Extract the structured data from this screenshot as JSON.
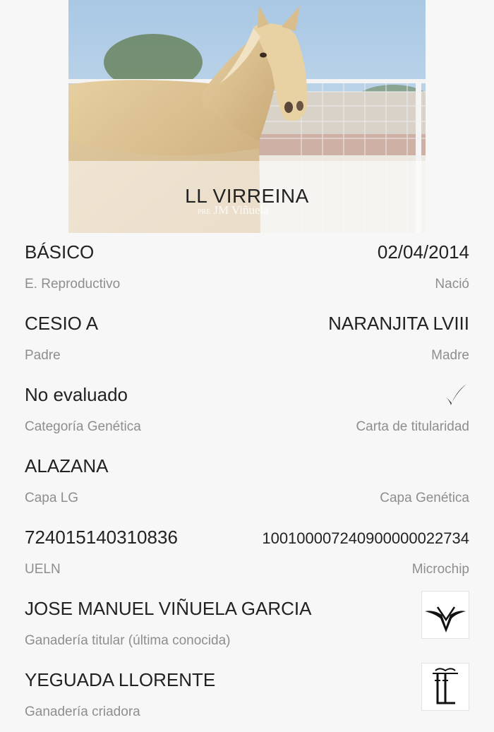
{
  "hero": {
    "horse_name": "LL VIRREINA",
    "watermark_prefix": "PRE",
    "watermark_text": "JM Viñuela"
  },
  "details": [
    {
      "left_value": "BÁSICO",
      "left_label": "E. Reproductivo",
      "right_value": "02/04/2014",
      "right_label": "Nació"
    },
    {
      "left_value": "CESIO A",
      "left_label": "Padre",
      "right_value": "NARANJITA LVIII",
      "right_label": "Madre"
    },
    {
      "left_value": "No evaluado",
      "left_label": "Categoría Genética",
      "right_icon": "checkmark-icon",
      "right_label": "Carta de titularidad"
    },
    {
      "left_value": "ALAZANA",
      "left_label": "Capa LG",
      "right_value": "",
      "right_label": "Capa Genética"
    },
    {
      "left_value": "724015140310836",
      "left_label": "UELN",
      "right_value": "100100007240900000022734",
      "right_label": "Microchip"
    }
  ],
  "owner": {
    "value": "JOSE MANUEL VIÑUELA GARCIA",
    "label": "Ganadería titular (última conocida)",
    "logo": "jmv-brand-logo"
  },
  "breeder": {
    "value": "YEGUADA LLORENTE",
    "label": "Ganadería criadora",
    "logo": "ll-brand-logo"
  }
}
